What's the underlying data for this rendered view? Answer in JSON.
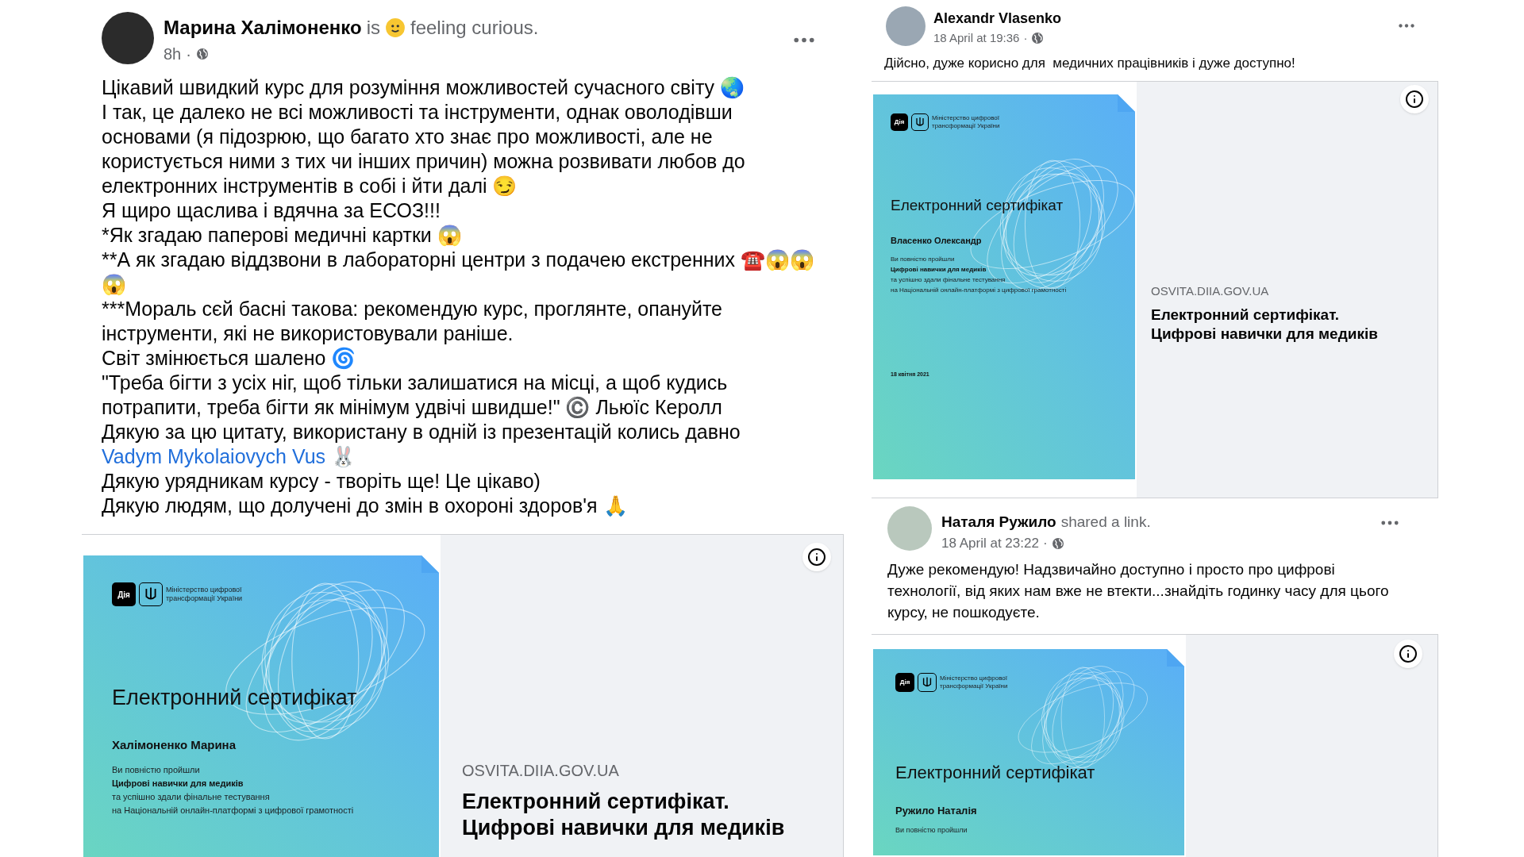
{
  "posts": [
    {
      "author": "Марина Халімоненко",
      "verb": "is",
      "feeling": "feeling curious.",
      "time": "8h",
      "separator": "·",
      "body": [
        {
          "text": "Цікавий швидкий курс для розуміння можливостей сучасного світу 🌏"
        },
        {
          "text": "І так, це далеко не всі можливості та інструменти, однак оволодівши основами (я підозрюю, що багато хто знає про можливості, але не користується ними з тих чи інших причин) можна розвивати любов до електронних інструментів в собі і йти далі 😏"
        },
        {
          "text": "Я щиро щаслива і вдячна за ЕСОЗ!!!"
        },
        {
          "text": "*Як згадаю паперові медичні картки 😱"
        },
        {
          "text": "**А як згадаю віддзвони в лабораторні центри з подачею екстренних ☎️😱😱😱"
        },
        {
          "text": "***Мораль сєй басні такова: рекомендую курс, проглянте, опануйте інструменти, які не використовували раніше."
        },
        {
          "text": "Світ змінюється шалено 🌀"
        },
        {
          "text": "\"Треба бігти з усіх ніг, щоб тільки залишатися на місці, а щоб кудись потрапити, треба бігти як мінімум удвічі швидше!\" ©️ Льюїс Керолл"
        },
        {
          "text": "Дякую за цю цитату, використану в одній із презентацій колись давно",
          "link": "Vadym Mykolaiovych Vus",
          "after": "🐰"
        },
        {
          "text": "Дякую урядникам курсу - творіть ще! Це цікаво)"
        },
        {
          "text": "Дякую людям, що долучені до змін в охороні здоров'я 🙏"
        }
      ],
      "preview": {
        "domain": "OSVITA.DIIA.GOV.UA",
        "title_lines": [
          "Електронний сертифікат.",
          "Цифрові навички для медиків"
        ],
        "certificate": {
          "logo": "Дія",
          "ministry": "Міністерство цифрової трансформації України",
          "title": "Електронний сертифікат",
          "name": "Халімоненко Марина",
          "lines": [
            {
              "kind": "plain",
              "text": "Ви повністю пройшли"
            },
            {
              "kind": "bold",
              "text": "Цифрові навички для медиків"
            },
            {
              "kind": "plain",
              "text": "та успішно здали фінальне тестування"
            },
            {
              "kind": "plain",
              "text": "на Національній онлайн-платформі з цифрової грамотності"
            }
          ]
        }
      }
    },
    {
      "author": "Alexandr Vlasenko",
      "time": "18 April at 19:36",
      "separator": "·",
      "body": [
        {
          "text": "Дійсно, дуже корисно для  медичних працівників і дуже доступно!"
        }
      ],
      "preview": {
        "domain": "OSVITA.DIIA.GOV.UA",
        "title_lines": [
          "Електронний сертифікат.",
          "Цифрові навички для медиків"
        ],
        "certificate": {
          "logo": "Дія",
          "ministry": "Міністерство цифрової трансформації України",
          "title": "Електронний сертифікат",
          "name": "Власенко Олександр",
          "lines": [
            {
              "kind": "plain",
              "text": "Ви повністю пройшли"
            },
            {
              "kind": "bold",
              "text": "Цифрові навички для медиків"
            },
            {
              "kind": "plain",
              "text": "та успішно здали фінальне тестування"
            },
            {
              "kind": "plain",
              "text": "на Національній онлайн-платформі з цифрової грамотності"
            }
          ],
          "date": "18 квітня 2021"
        }
      }
    },
    {
      "author": "Наталя Ружило",
      "verb": "shared a link.",
      "time": "18 April at 23:22",
      "separator": "·",
      "body": [
        {
          "text": "Дуже рекомендую! Надзвичайно доступно і просто про цифрові технології, від яких нам вже не втекти...знайдіть годинку часу для цього курсу, не пошкодуєте."
        }
      ],
      "preview": {
        "certificate": {
          "logo": "Дія",
          "ministry": "Міністерство цифрової трансформації України",
          "title": "Електронний сертифікат",
          "name": "Ружило Наталія",
          "lines": [
            {
              "kind": "plain",
              "text": "Ви повністю пройшли"
            }
          ]
        }
      }
    }
  ]
}
